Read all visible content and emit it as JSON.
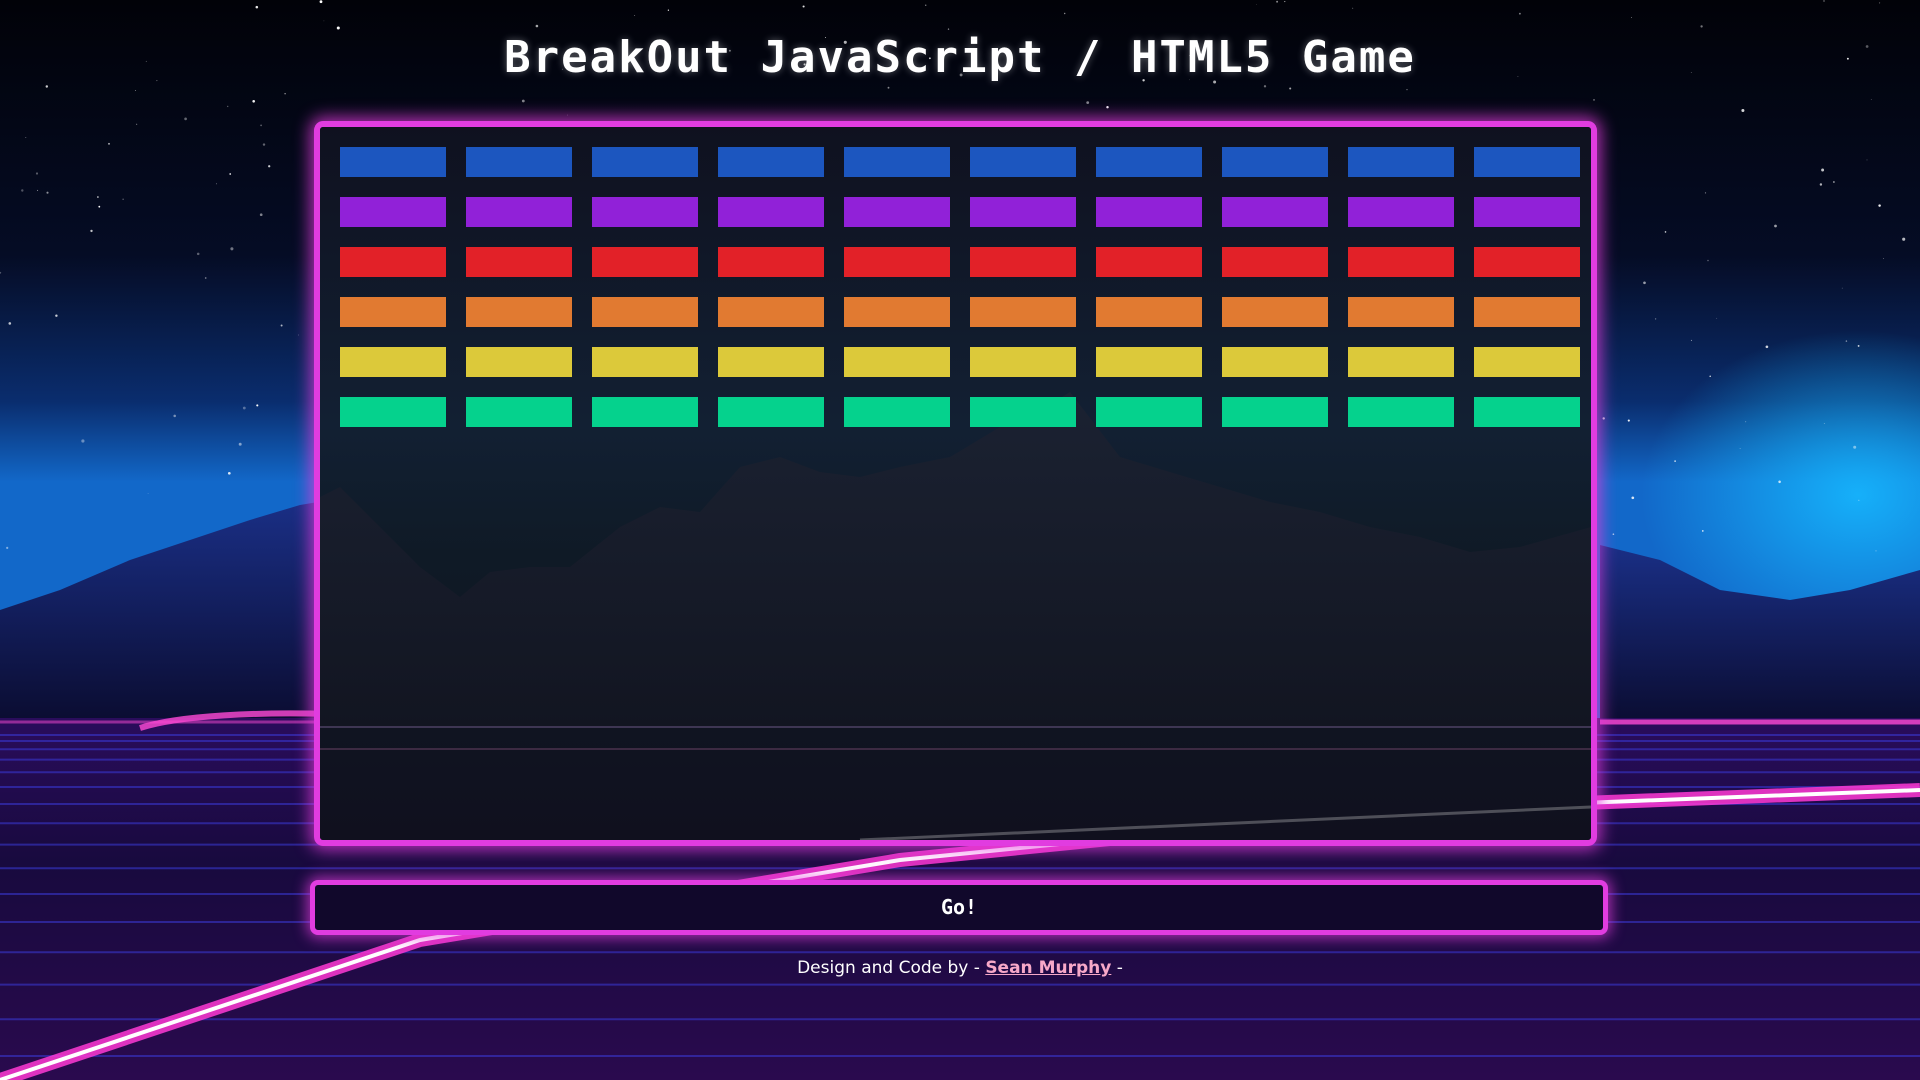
{
  "page": {
    "title": "BreakOut JavaScript / HTML5 Game"
  },
  "game": {
    "brick_columns": 10,
    "brick_rows": [
      {
        "color": "#1c56bf"
      },
      {
        "color": "#9121d8"
      },
      {
        "color": "#e22128"
      },
      {
        "color": "#e17a31"
      },
      {
        "color": "#dcc93a"
      },
      {
        "color": "#05d28d"
      }
    ],
    "start_button_label": "Go!"
  },
  "footer": {
    "prefix": "Design and Code by -",
    "author_name": "Sean Murphy",
    "suffix": "-"
  },
  "theme": {
    "accent": "#e13ce0",
    "board_background": "#121426",
    "link_color": "#f7a8c8"
  }
}
